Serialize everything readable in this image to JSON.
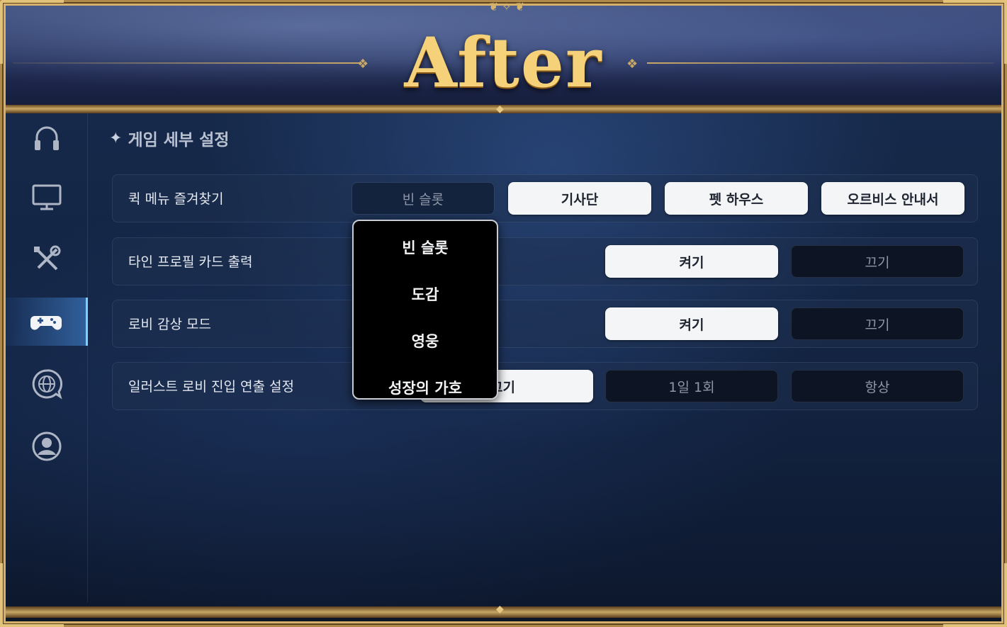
{
  "banner": {
    "title": "After"
  },
  "sidebar": {
    "items": [
      {
        "name": "audio",
        "icon": "headphones-icon",
        "active": false
      },
      {
        "name": "display",
        "icon": "monitor-icon",
        "active": false
      },
      {
        "name": "controls",
        "icon": "tools-icon",
        "active": false
      },
      {
        "name": "game",
        "icon": "gamepad-icon",
        "active": true
      },
      {
        "name": "language",
        "icon": "globe-chat-icon",
        "active": false
      },
      {
        "name": "account",
        "icon": "user-circle-icon",
        "active": false
      }
    ]
  },
  "section": {
    "title": "게임 세부 설정"
  },
  "settings": {
    "quick_menu": {
      "label": "퀵 메뉴 즐겨찾기",
      "selected": "빈 슬롯",
      "options": [
        "기사단",
        "펫 하우스",
        "오르비스 안내서"
      ]
    },
    "profile_card": {
      "label": "타인 프로필 카드 출력",
      "on_label": "켜기",
      "off_label": "끄기"
    },
    "lobby_mode": {
      "label": "로비 감상 모드",
      "on_label": "켜기",
      "off_label": "끄기"
    },
    "illust_lobby": {
      "label": "일러스트 로비 진입 연출 설정",
      "options": [
        "끄기",
        "1일 1회",
        "항상"
      ]
    }
  },
  "dropdown": {
    "items": [
      "빈 슬롯",
      "도감",
      "영웅",
      "성장의 가호"
    ]
  },
  "colors": {
    "accent": "#7fd0ff",
    "gold": "#c9a766",
    "button_on": "#f4f5f7",
    "button_off": "#0d1524"
  }
}
